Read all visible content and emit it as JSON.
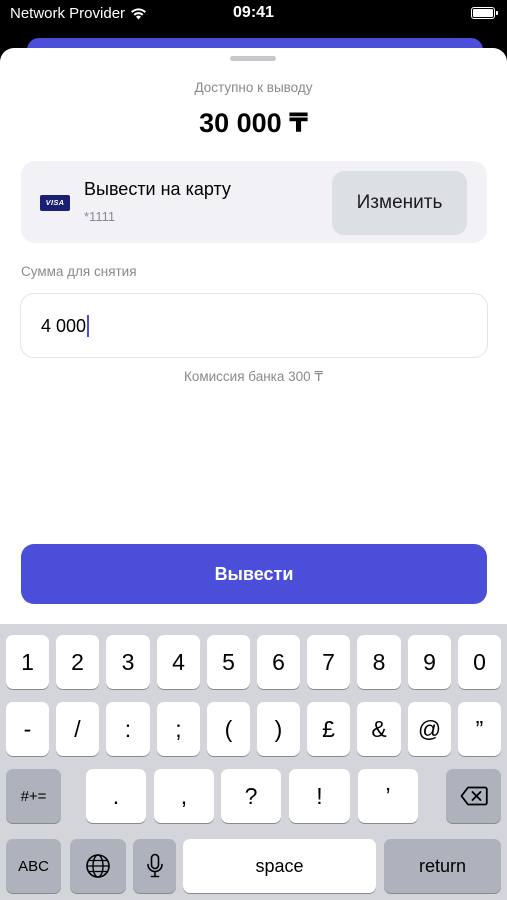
{
  "status_bar": {
    "carrier": "Network Provider",
    "time": "09:41",
    "wifi_icon": "wifi-icon",
    "battery_icon": "battery-icon"
  },
  "sheet": {
    "available_label": "Доступно к выводу",
    "available_amount": "30 000 ₸",
    "card": {
      "icon": "visa-card-icon",
      "brand": "VISA",
      "title": "Вывести на карту",
      "number": "*1111",
      "change_label": "Изменить"
    },
    "amount": {
      "label": "Сумма для снятия",
      "value": "4 000"
    },
    "fee_text": "Комиссия банка 300 ₸",
    "withdraw_label": "Вывести"
  },
  "keyboard": {
    "row1": [
      "1",
      "2",
      "3",
      "4",
      "5",
      "6",
      "7",
      "8",
      "9",
      "0"
    ],
    "row2": [
      "-",
      "/",
      ":",
      ";",
      "(",
      ")",
      "£",
      "&",
      "@",
      "”"
    ],
    "symbols_label": "#+=",
    "row3": [
      ".",
      ",",
      "?",
      "!",
      "’"
    ],
    "delete_icon": "backspace-icon",
    "abc_label": "ABC",
    "globe_icon": "globe-icon",
    "mic_icon": "microphone-icon",
    "space_label": "space",
    "return_label": "return"
  },
  "colors": {
    "accent": "#4a4ed9",
    "card_bg": "#f2f2f6",
    "keyboard_bg": "#d3d5db"
  }
}
